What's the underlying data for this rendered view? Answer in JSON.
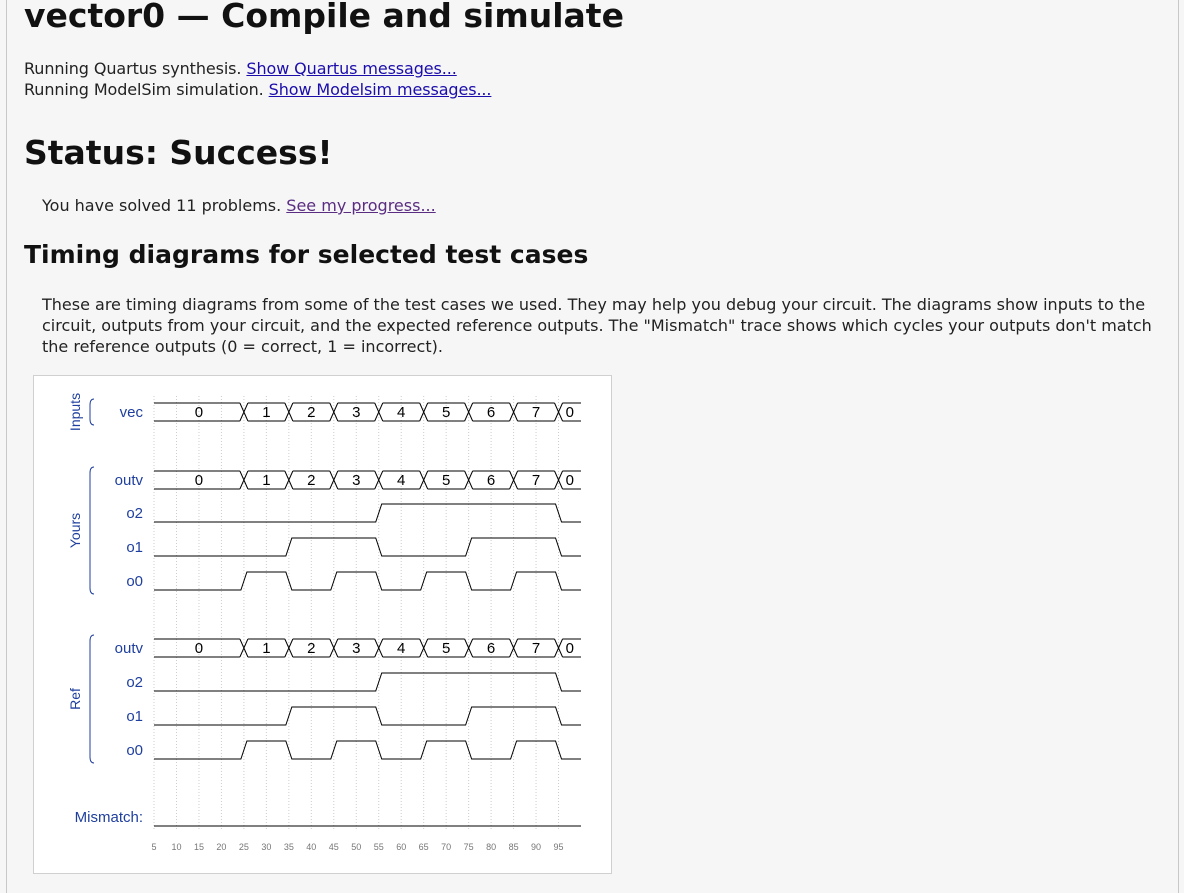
{
  "page": {
    "title": "vector0 — Compile and simulate",
    "messages": [
      {
        "text": "Running Quartus synthesis.",
        "link": "Show Quartus messages..."
      },
      {
        "text": "Running ModelSim simulation.",
        "link": "Show Modelsim messages..."
      }
    ],
    "status": "Status: Success!",
    "solved_prefix": "You have solved 11 problems.",
    "solved_link": "See my progress...",
    "timing_heading": "Timing diagrams for selected test cases",
    "timing_description": "These are timing diagrams from some of the test cases we used. They may help you debug your circuit. The diagrams show inputs to the circuit, outputs from your circuit, and the expected reference outputs. The \"Mismatch\" trace shows which cycles your outputs don't match the reference outputs (0 = correct, 1 = incorrect)."
  },
  "waveform": {
    "groups": [
      {
        "label": "Inputs",
        "signals": [
          "vec"
        ]
      },
      {
        "label": "Yours",
        "signals": [
          "outv",
          "o2",
          "o1",
          "o0"
        ]
      },
      {
        "label": "Ref",
        "signals": [
          "outv",
          "o2",
          "o1",
          "o0"
        ]
      }
    ],
    "mismatch_label": "Mismatch:",
    "time_ticks": [
      5,
      10,
      15,
      20,
      25,
      30,
      35,
      40,
      45,
      50,
      55,
      60,
      65,
      70,
      75,
      80,
      85,
      90,
      95
    ],
    "bus_segments": [
      {
        "start": 5,
        "end": 25,
        "value": "0"
      },
      {
        "start": 25,
        "end": 35,
        "value": "1"
      },
      {
        "start": 35,
        "end": 45,
        "value": "2"
      },
      {
        "start": 45,
        "end": 55,
        "value": "3"
      },
      {
        "start": 55,
        "end": 65,
        "value": "4"
      },
      {
        "start": 65,
        "end": 75,
        "value": "5"
      },
      {
        "start": 75,
        "end": 85,
        "value": "6"
      },
      {
        "start": 85,
        "end": 95,
        "value": "7"
      },
      {
        "start": 95,
        "end": 100,
        "value": "0"
      }
    ],
    "bit_signals": {
      "o2": [
        [
          5,
          0
        ],
        [
          55,
          1
        ],
        [
          95,
          0
        ]
      ],
      "o1": [
        [
          5,
          0
        ],
        [
          35,
          1
        ],
        [
          55,
          0
        ],
        [
          75,
          1
        ],
        [
          95,
          0
        ]
      ],
      "o0": [
        [
          5,
          0
        ],
        [
          25,
          1
        ],
        [
          35,
          0
        ],
        [
          45,
          1
        ],
        [
          55,
          0
        ],
        [
          65,
          1
        ],
        [
          75,
          0
        ],
        [
          85,
          1
        ],
        [
          95,
          0
        ]
      ]
    },
    "mismatch": [
      [
        5,
        0
      ]
    ],
    "time_range": [
      5,
      100
    ],
    "colors": {
      "label": "#1f3f9f",
      "trace": "#000000",
      "grid": "#cccccc",
      "axis": "#777777"
    }
  }
}
